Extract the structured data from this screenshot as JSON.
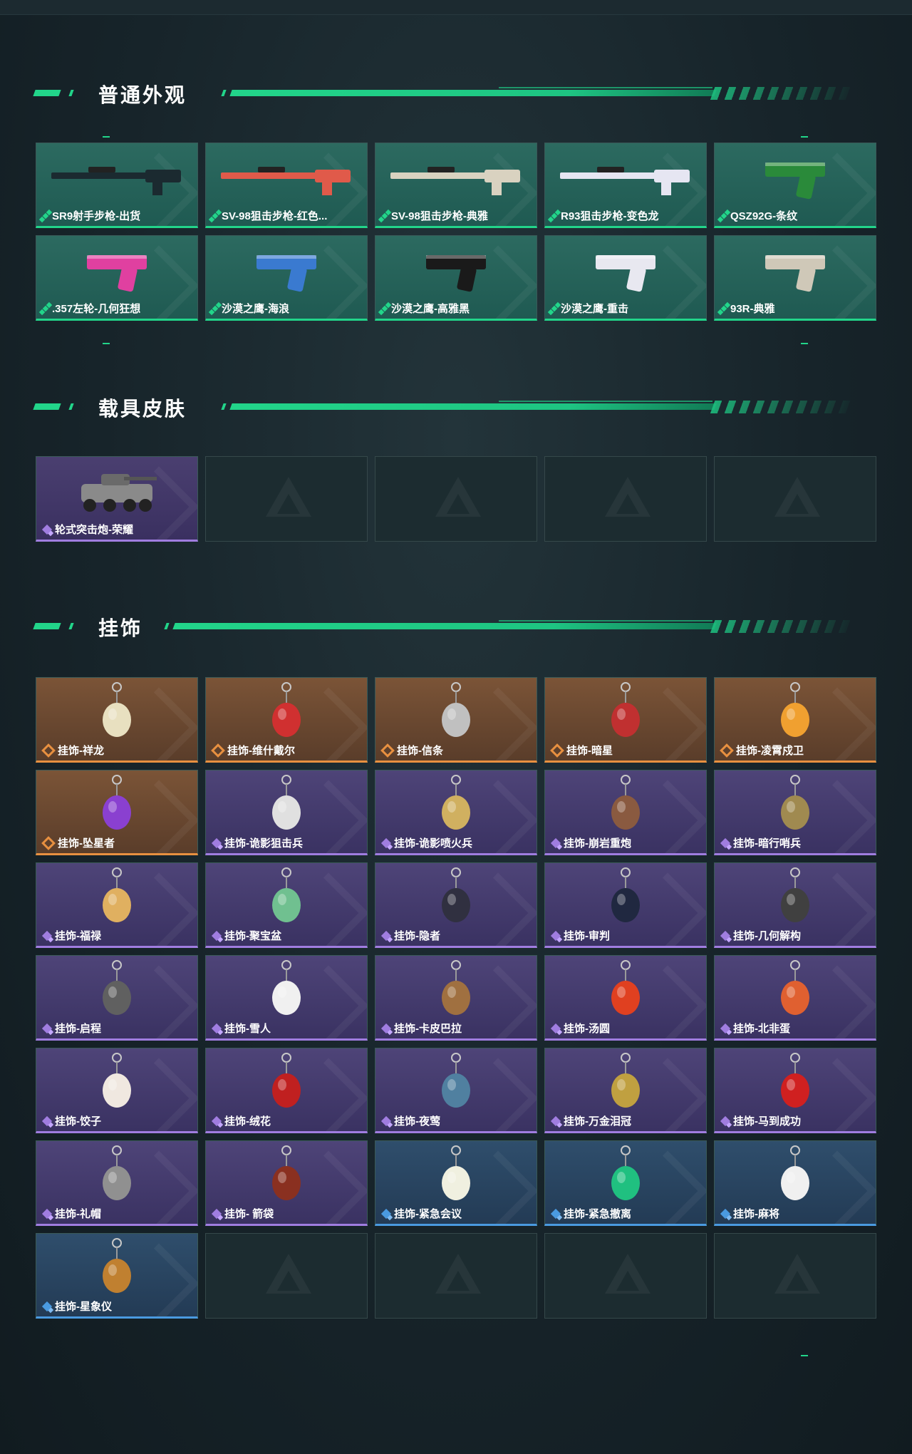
{
  "sections": {
    "weapons": {
      "title": "普通外观"
    },
    "vehicles": {
      "title": "载具皮肤"
    },
    "charms": {
      "title": "挂饰"
    }
  },
  "weapons": [
    {
      "label": "SR9射手步枪-出货",
      "rarity": "green",
      "icon": "rifle-icon",
      "color": "#1b2a30"
    },
    {
      "label": "SV-98狙击步枪-红色...",
      "rarity": "green",
      "icon": "sniper-rifle-icon",
      "color": "#e05a4a"
    },
    {
      "label": "SV-98狙击步枪-典雅",
      "rarity": "green",
      "icon": "sniper-rifle-icon",
      "color": "#d9d2c0"
    },
    {
      "label": "R93狙击步枪-变色龙",
      "rarity": "green",
      "icon": "sniper-rifle-icon",
      "color": "#e6e6f2"
    },
    {
      "label": "QSZ92G-条纹",
      "rarity": "green",
      "icon": "pistol-icon",
      "color": "#2a8a3a"
    },
    {
      "label": ".357左轮-几何狂想",
      "rarity": "green",
      "icon": "revolver-icon",
      "color": "#e040a0"
    },
    {
      "label": "沙漠之鹰-海浪",
      "rarity": "green",
      "icon": "pistol-icon",
      "color": "#3a7ad0"
    },
    {
      "label": "沙漠之鹰-高雅黑",
      "rarity": "green",
      "icon": "pistol-icon",
      "color": "#1a1a1a"
    },
    {
      "label": "沙漠之鹰-重击",
      "rarity": "green",
      "icon": "pistol-icon",
      "color": "#e8e8f0"
    },
    {
      "label": "93R-典雅",
      "rarity": "green",
      "icon": "pistol-icon",
      "color": "#cfc8b8"
    }
  ],
  "vehicles": [
    {
      "label": "轮式突击炮-荣耀",
      "rarity": "purple",
      "icon": "armored-vehicle-icon",
      "color": "#8a8a8a"
    }
  ],
  "charms": [
    {
      "label": "挂饰-祥龙",
      "rarity": "orange",
      "color": "#e8e0c0"
    },
    {
      "label": "挂饰-维什戴尔",
      "rarity": "orange",
      "color": "#d03030"
    },
    {
      "label": "挂饰-信条",
      "rarity": "orange",
      "color": "#c0c0c0"
    },
    {
      "label": "挂饰-暗星",
      "rarity": "orange",
      "color": "#c03030"
    },
    {
      "label": "挂饰-凌霄戍卫",
      "rarity": "orange",
      "color": "#f0a030"
    },
    {
      "label": "挂饰-坠星者",
      "rarity": "orange",
      "color": "#8a40d0"
    },
    {
      "label": "挂饰-诡影狙击兵",
      "rarity": "purple",
      "color": "#e0e0e0"
    },
    {
      "label": "挂饰-诡影喷火兵",
      "rarity": "purple",
      "color": "#d0b060"
    },
    {
      "label": "挂饰-崩岩重炮",
      "rarity": "purple",
      "color": "#8a5a40"
    },
    {
      "label": "挂饰-暗行哨兵",
      "rarity": "purple",
      "color": "#a08a50"
    },
    {
      "label": "挂饰-福禄",
      "rarity": "purple",
      "color": "#e0b060"
    },
    {
      "label": "挂饰-聚宝盆",
      "rarity": "purple",
      "color": "#70c090"
    },
    {
      "label": "挂饰-隐者",
      "rarity": "purple",
      "color": "#303040"
    },
    {
      "label": "挂饰-审判",
      "rarity": "purple",
      "color": "#202840"
    },
    {
      "label": "挂饰-几何解构",
      "rarity": "purple",
      "color": "#404040"
    },
    {
      "label": "挂饰-启程",
      "rarity": "purple",
      "color": "#606060"
    },
    {
      "label": "挂饰-雪人",
      "rarity": "purple",
      "color": "#f0f0f0"
    },
    {
      "label": "挂饰-卡皮巴拉",
      "rarity": "purple",
      "color": "#a07040"
    },
    {
      "label": "挂饰-汤圆",
      "rarity": "purple",
      "color": "#e04020"
    },
    {
      "label": "挂饰-北非蛋",
      "rarity": "purple",
      "color": "#e06030"
    },
    {
      "label": "挂饰-饺子",
      "rarity": "purple",
      "color": "#f0e8e0"
    },
    {
      "label": "挂饰-绒花",
      "rarity": "purple",
      "color": "#c02020"
    },
    {
      "label": "挂饰-夜莺",
      "rarity": "purple",
      "color": "#5080a0"
    },
    {
      "label": "挂饰-万金泪冠",
      "rarity": "purple",
      "color": "#c0a040"
    },
    {
      "label": "挂饰-马到成功",
      "rarity": "purple",
      "color": "#d02020"
    },
    {
      "label": "挂饰-礼帽",
      "rarity": "purple",
      "color": "#909090"
    },
    {
      "label": "挂饰- 箭袋",
      "rarity": "purple",
      "color": "#8a3020"
    },
    {
      "label": "挂饰-紧急会议",
      "rarity": "blue",
      "color": "#f0f0e0"
    },
    {
      "label": "挂饰-紧急撤离",
      "rarity": "blue",
      "color": "#20c080"
    },
    {
      "label": "挂饰-麻将",
      "rarity": "blue",
      "color": "#f0f0f0"
    },
    {
      "label": "挂饰-星象仪",
      "rarity": "blue",
      "color": "#c08030"
    }
  ],
  "colors": {
    "accent": "#22d58a",
    "green_rarity": "#22d58a",
    "purple_rarity": "#a07de0",
    "orange_rarity": "#e89040",
    "blue_rarity": "#4a9ae0"
  }
}
